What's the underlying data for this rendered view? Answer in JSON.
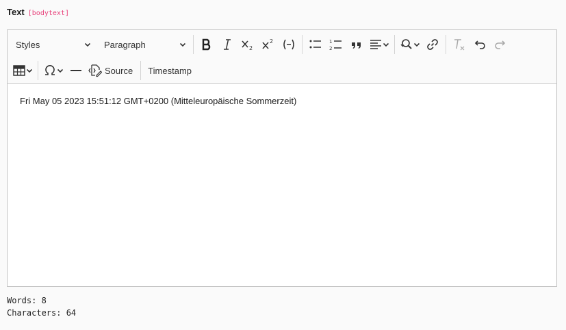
{
  "field": {
    "label": "Text",
    "key": "[bodytext]"
  },
  "toolbar": {
    "styles_label": "Styles",
    "heading_label": "Paragraph",
    "source_label": "Source",
    "timestamp_label": "Timestamp"
  },
  "content": {
    "text": "Fri May 05 2023 15:51:12 GMT+0200 (Mitteleuropäische Sommerzeit)"
  },
  "stats": {
    "words": "Words: 8",
    "characters": "Characters: 64"
  }
}
